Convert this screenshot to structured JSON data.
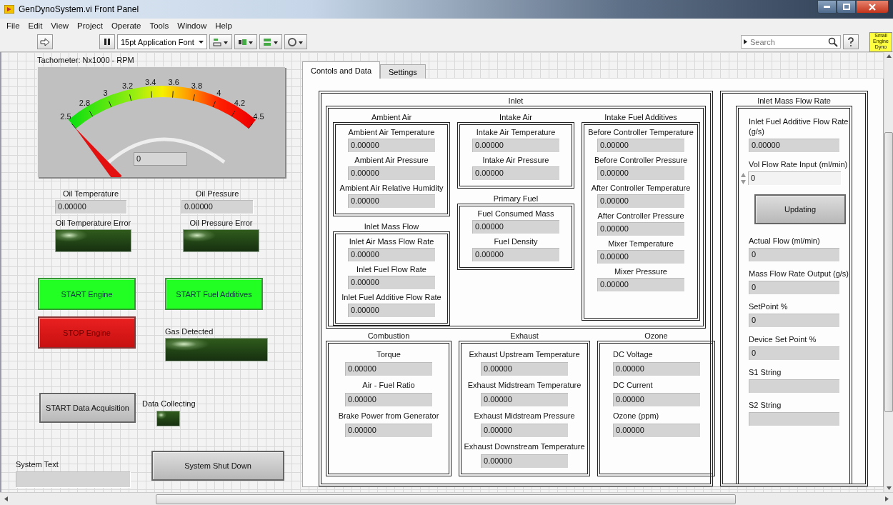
{
  "window": {
    "title": "GenDynoSystem.vi Front Panel"
  },
  "menu": [
    "File",
    "Edit",
    "View",
    "Project",
    "Operate",
    "Tools",
    "Window",
    "Help"
  ],
  "toolbar": {
    "font": "15pt Application Font",
    "search": {
      "placeholder": "Search"
    },
    "logo": "Small Engine Dyno"
  },
  "tachometer": {
    "label": "Tachometer: Nx1000 - RPM",
    "ticks": [
      "2.5",
      "2.8",
      "3",
      "3.2",
      "3.4",
      "3.6",
      "3.8",
      "4",
      "4.2",
      "4.5"
    ],
    "value": "0"
  },
  "oil_indicators": [
    {
      "label": "Oil Temperature",
      "value": "0.00000"
    },
    {
      "label": "Oil Pressure",
      "value": "0.00000"
    }
  ],
  "oil_leds": [
    {
      "label": "Oil Temperature Error",
      "on": false
    },
    {
      "label": "Oil Pressure Error",
      "on": false
    }
  ],
  "engine_buttons": [
    {
      "label": "START Engine",
      "kind": "start"
    },
    {
      "label": "START Fuel Additives",
      "kind": "start"
    },
    {
      "label": "STOP Engine",
      "kind": "stop"
    }
  ],
  "gas_led": {
    "label": "Gas Detected",
    "on": false
  },
  "daq_button": {
    "label": "START Data Acquisition"
  },
  "data_led": {
    "label": "Data Collecting",
    "on": false
  },
  "system_text": {
    "label": "System Text"
  },
  "shutdown_button": {
    "label": "System Shut Down"
  },
  "tabs": [
    {
      "label": "Contols and Data",
      "selected": true
    },
    {
      "label": "Settings",
      "selected": false
    }
  ],
  "inlet": {
    "title": "Inlet",
    "columns": [
      [
        {
          "title": "Ambient Air",
          "fields": [
            {
              "label": "Ambient Air Temperature",
              "value": "0.00000"
            },
            {
              "label": "Ambient Air Pressure",
              "value": "0.00000"
            },
            {
              "label": "Ambient Air Relative Humidity",
              "value": "0.00000"
            }
          ]
        },
        {
          "title": "Inlet Mass Flow",
          "fields": [
            {
              "label": "Inlet Air Mass Flow Rate",
              "value": "0.00000"
            },
            {
              "label": "Inlet Fuel Flow Rate",
              "value": "0.00000"
            },
            {
              "label": "Inlet Fuel Additive Flow Rate",
              "value": "0.00000"
            }
          ]
        }
      ],
      [
        {
          "title": "Intake Air",
          "fields": [
            {
              "label": "Intake Air Temperature",
              "value": "0.00000"
            },
            {
              "label": "Intake Air Pressure",
              "value": "0.00000"
            }
          ]
        },
        {
          "title": "Primary Fuel",
          "fields": [
            {
              "label": "Fuel Consumed Mass",
              "value": "0.00000"
            },
            {
              "label": "Fuel Density",
              "value": "0.00000"
            }
          ]
        }
      ],
      [
        {
          "title": "Intake Fuel Additives",
          "fields": [
            {
              "label": "Before Controller Temperature",
              "value": "0.00000"
            },
            {
              "label": "Before Controller Pressure",
              "value": "0.00000"
            },
            {
              "label": "After Controller Temperature",
              "value": "0.00000"
            },
            {
              "label": "After Controller Pressure",
              "value": "0.00000"
            },
            {
              "label": "Mixer Temperature",
              "value": "0.00000"
            },
            {
              "label": "Mixer Pressure",
              "value": "0.00000"
            }
          ]
        }
      ]
    ]
  },
  "lower_groups": [
    {
      "title": "Combustion",
      "fields": [
        {
          "label": "Torque",
          "value": "0.00000"
        },
        {
          "label": "Air - Fuel Ratio",
          "value": "0.00000"
        },
        {
          "label": "Brake Power from Generator",
          "value": "0.00000"
        }
      ]
    },
    {
      "title": "Exhaust",
      "fields": [
        {
          "label": "Exhaust Upstream Temperature",
          "value": "0.00000"
        },
        {
          "label": "Exhaust Midstream Temperature",
          "value": "0.00000"
        },
        {
          "label": "Exhaust Midstream Pressure",
          "value": "0.00000"
        },
        {
          "label": "Exhaust Downstream Temperature",
          "value": "0.00000"
        }
      ]
    },
    {
      "title": "Ozone",
      "fields": [
        {
          "label": "DC Voltage",
          "value": "0.00000"
        },
        {
          "label": "DC Current",
          "value": "0.00000"
        },
        {
          "label": "Ozone (ppm)",
          "value": "0.00000"
        }
      ]
    }
  ],
  "flow_panel": {
    "title": "Inlet Mass Flow Rate",
    "items": [
      {
        "kind": "indicator",
        "label": "Inlet Fuel Additive Flow Rate (g/s)",
        "value": "0.00000"
      },
      {
        "kind": "control",
        "label": "Vol Flow Rate Input (ml/min)",
        "value": "0"
      },
      {
        "kind": "button",
        "label": "Updating"
      },
      {
        "kind": "indicator",
        "label": "Actual Flow (ml/min)",
        "value": "0"
      },
      {
        "kind": "indicator",
        "label": "Mass Flow Rate Output (g/s)",
        "value": "0"
      },
      {
        "kind": "indicator",
        "label": "SetPoint %",
        "value": "0"
      },
      {
        "kind": "indicator",
        "label": "Device Set Point %",
        "value": "0"
      },
      {
        "kind": "indicator",
        "label": "S1 String"
      },
      {
        "kind": "indicator",
        "label": "S2 String"
      }
    ]
  }
}
